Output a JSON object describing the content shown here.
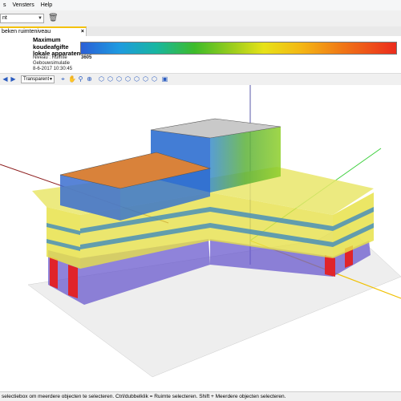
{
  "menubar": {
    "items": [
      "s",
      "Vensters",
      "Help"
    ]
  },
  "toolbar": {
    "combo_value": "nt"
  },
  "tab": {
    "label": "beken ruimteniveau",
    "close": "×"
  },
  "legend": {
    "title": "Maximum koudeafgifte lokale apparaten",
    "level_label": "Niveau : Ruimte",
    "value": "3605",
    "subtitle": "Gebouwsimulatie",
    "timestamp": "8-6-2017 10:30:45",
    "gradient_colors": [
      "#2b5fd6",
      "#3dbb2a",
      "#e7e218",
      "#ec2b1c"
    ]
  },
  "viewbar": {
    "mode": "Transparent",
    "icons": [
      "select-icon",
      "hand-icon",
      "zoom-icon",
      "zoom-extent-icon",
      "view-front-icon",
      "view-back-icon",
      "view-left-icon",
      "view-right-icon",
      "view-top-icon",
      "view-iso-icon",
      "view-persp-icon",
      "frame-icon"
    ]
  },
  "status": {
    "text": "selectiebox om meerdere objecten te selecteren. Ctrl/dubbelklik = Ruimte selecteren. Shift + Meerdere objecten selecteren."
  }
}
